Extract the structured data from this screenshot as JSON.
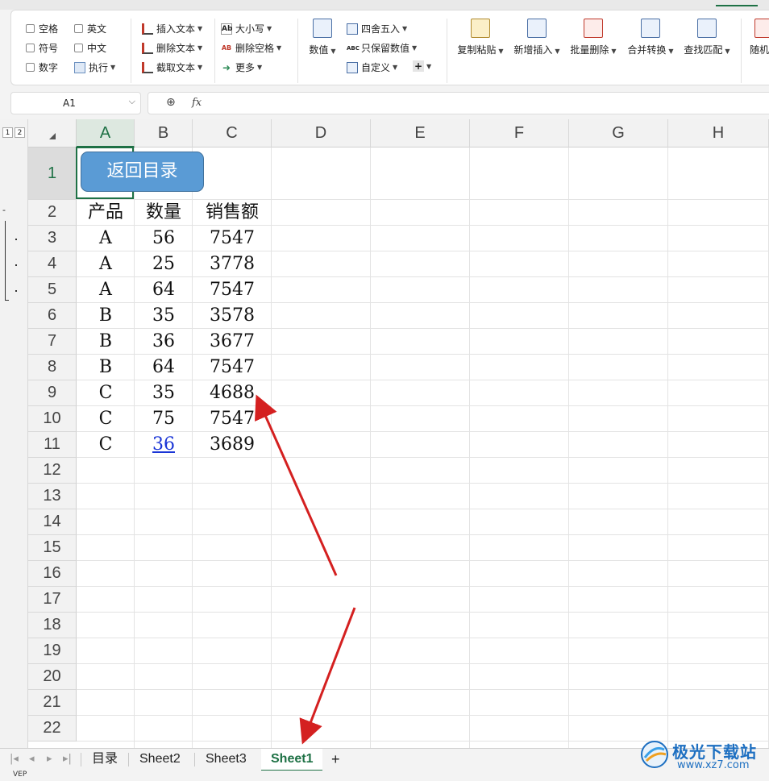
{
  "ribbon": {
    "checkboxes": [
      "空格",
      "英文",
      "符号",
      "中文",
      "数字"
    ],
    "execute_label": "执行",
    "text_tools": [
      "插入文本",
      "删除文本",
      "截取文本"
    ],
    "case_label": "大小写",
    "remove_space_label": "删除空格",
    "more_label": "更多",
    "number_label": "数值",
    "round_label": "四舍五入",
    "keep_value_label": "只保留数值",
    "custom_label": "自定义",
    "plus_label": "+",
    "big_buttons": [
      "复制粘贴",
      "新增插入",
      "批量删除",
      "合并转换",
      "查找匹配",
      "随机"
    ]
  },
  "formula_bar": {
    "name_box": "A1",
    "fx": "fx",
    "value": ""
  },
  "outline": {
    "levels": [
      "1",
      "2"
    ],
    "collapse": "-"
  },
  "columns": [
    "A",
    "B",
    "C",
    "D",
    "E",
    "F",
    "G",
    "H"
  ],
  "rows": [
    "1",
    "2",
    "3",
    "4",
    "5",
    "6",
    "7",
    "8",
    "9",
    "10",
    "11",
    "12",
    "13",
    "14",
    "15",
    "16",
    "17",
    "18",
    "19",
    "20",
    "21",
    "22"
  ],
  "nav_button": "返回目录",
  "table": {
    "headers": [
      "产品",
      "数量",
      "销售额"
    ],
    "rows": [
      [
        "A",
        "56",
        "7547"
      ],
      [
        "A",
        "25",
        "3778"
      ],
      [
        "A",
        "64",
        "7547"
      ],
      [
        "B",
        "35",
        "3578"
      ],
      [
        "B",
        "36",
        "3677"
      ],
      [
        "B",
        "64",
        "7547"
      ],
      [
        "C",
        "35",
        "4688"
      ],
      [
        "C",
        "75",
        "7547"
      ],
      [
        "C",
        "36",
        "3689"
      ]
    ]
  },
  "sheet_tabs": [
    "目录",
    "Sheet2",
    "Sheet3",
    "Sheet1"
  ],
  "active_sheet": "Sheet1",
  "add_sheet": "+",
  "status_icon": "VEP",
  "watermark": {
    "title": "极光下载站",
    "url": "www.xz7.com"
  },
  "colors": {
    "accent": "#1e7145",
    "button_fill": "#5a9bd5",
    "link": "#1a35d6",
    "annotation_arrow": "#d42020"
  }
}
